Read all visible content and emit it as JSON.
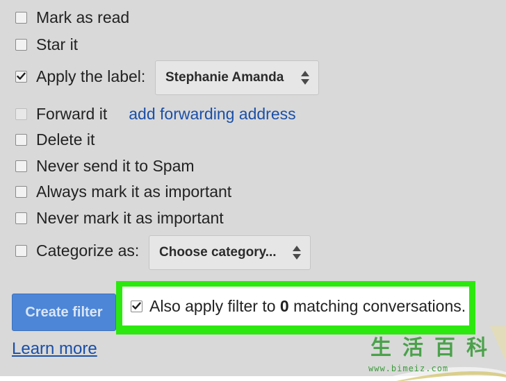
{
  "options": {
    "mark_as_read": {
      "label": "Mark as read",
      "checked": false
    },
    "star_it": {
      "label": "Star it",
      "checked": false
    },
    "apply_label": {
      "label": "Apply the label:",
      "checked": true,
      "selected": "Stephanie Amanda"
    },
    "forward_it": {
      "label": "Forward it",
      "checked": false,
      "disabled": true,
      "link": "add forwarding address"
    },
    "delete_it": {
      "label": "Delete it",
      "checked": false
    },
    "never_spam": {
      "label": "Never send it to Spam",
      "checked": false
    },
    "always_important": {
      "label": "Always mark it as important",
      "checked": false
    },
    "never_important": {
      "label": "Never mark it as important",
      "checked": false
    },
    "categorize": {
      "label": "Categorize as:",
      "checked": false,
      "selected": "Choose category..."
    }
  },
  "actions": {
    "create_filter_label": "Create filter",
    "also_apply": {
      "checked": true,
      "prefix": "Also apply filter to ",
      "count": "0",
      "suffix": " matching conversations."
    },
    "learn_more": "Learn more"
  },
  "watermark": {
    "chars": [
      "生",
      "活",
      "百",
      "科"
    ],
    "url": "www.bimeiz.com"
  },
  "colors": {
    "panel_bg": "#d9d9d9",
    "link": "#1a4fa8",
    "primary_button": "#4d86d7",
    "highlight": "#2de80f"
  }
}
